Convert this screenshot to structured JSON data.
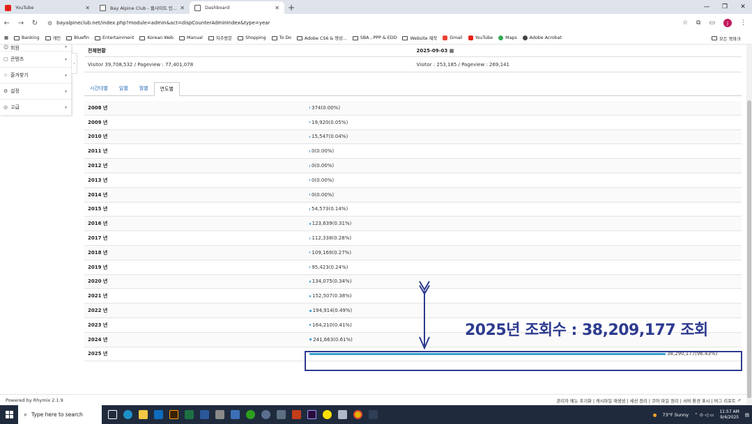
{
  "browser": {
    "tabs": [
      {
        "title": "YouTube",
        "favicon": "youtube-icon",
        "active": false
      },
      {
        "title": "Bay Alpine Club - 웹사이트 인...",
        "favicon": "site-logo-icon",
        "active": false
      },
      {
        "title": "Dashboard",
        "favicon": "site-logo-icon",
        "active": true
      }
    ],
    "url": "bayalpineclub.net/index.php?module=admin&act=dispCounterAdminIndex&type=year",
    "bookmarks": [
      "Banking",
      "개인",
      "Bluefin",
      "Entertainment",
      "Korean Web",
      "Manual",
      "자주방문",
      "Shopping",
      "To Do",
      "Adobe CS6 & 영상...",
      "SBA , PPP & EDD",
      "Website 제작",
      "Gmail",
      "YouTube",
      "Maps",
      "Adobe Acrobat"
    ],
    "all_bookmarks": "모든 북마크",
    "profile_initial": "J"
  },
  "sidebar": {
    "items": [
      {
        "icon": "people-icon",
        "label": "회원"
      },
      {
        "icon": "content-icon",
        "label": "콘텐츠"
      },
      {
        "icon": "star-icon",
        "label": "즐겨찾기"
      },
      {
        "icon": "gear-icon",
        "label": "설정"
      },
      {
        "icon": "advanced-icon",
        "label": "고급"
      }
    ]
  },
  "summary": {
    "left_title": "전체현황",
    "right_title": "2025-09-03",
    "left_stats": "Visitor 39,708,532 / Pageview : 77,401,078",
    "right_stats": "Visitor : 253,185 / Pageview : 269,141"
  },
  "period_tabs": [
    {
      "label": "시간대별",
      "active": false
    },
    {
      "label": "일별",
      "active": false
    },
    {
      "label": "월별",
      "active": false
    },
    {
      "label": "연도별",
      "active": true
    }
  ],
  "years": [
    {
      "year": "2008 년",
      "value": "374(0.00%)",
      "percent": 0.0
    },
    {
      "year": "2009 년",
      "value": "19,920(0.05%)",
      "percent": 0.05
    },
    {
      "year": "2010 년",
      "value": "15,547(0.04%)",
      "percent": 0.04
    },
    {
      "year": "2011 년",
      "value": "0(0.00%)",
      "percent": 0.0
    },
    {
      "year": "2012 년",
      "value": "0(0.00%)",
      "percent": 0.0
    },
    {
      "year": "2013 년",
      "value": "0(0.00%)",
      "percent": 0.0
    },
    {
      "year": "2014 년",
      "value": "0(0.00%)",
      "percent": 0.0
    },
    {
      "year": "2015 년",
      "value": "54,573(0.14%)",
      "percent": 0.14
    },
    {
      "year": "2016 년",
      "value": "123,639(0.31%)",
      "percent": 0.31
    },
    {
      "year": "2017 년",
      "value": "112,338(0.28%)",
      "percent": 0.28
    },
    {
      "year": "2018 년",
      "value": "109,169(0.27%)",
      "percent": 0.27
    },
    {
      "year": "2019 년",
      "value": "95,423(0.24%)",
      "percent": 0.24
    },
    {
      "year": "2020 년",
      "value": "134,075(0.34%)",
      "percent": 0.34
    },
    {
      "year": "2021 년",
      "value": "152,507(0.38%)",
      "percent": 0.38
    },
    {
      "year": "2022 년",
      "value": "194,914(0.49%)",
      "percent": 0.49
    },
    {
      "year": "2023 년",
      "value": "164,210(0.41%)",
      "percent": 0.41
    },
    {
      "year": "2024 년",
      "value": "241,663(0.61%)",
      "percent": 0.61
    },
    {
      "year": "2025 년",
      "value": "38,290,177(96.43%)",
      "percent": 96.43
    }
  ],
  "annotation": {
    "text": "2025년 조회수 : 38,209,177  조회",
    "color": "#2d3b8f"
  },
  "footer": {
    "powered": "Powered by Rhymix 2.1.9",
    "links": "관리자 메뉴 초기화 | 캐시파일 재생성 | 세션 정리 | 코어 파일 정리 | 서버 환경 표시 | 버그 리포트"
  },
  "taskbar": {
    "search_placeholder": "Type here to search",
    "weather": "73°F  Sunny",
    "time": "11:57 AM",
    "date": "9/4/2025"
  }
}
